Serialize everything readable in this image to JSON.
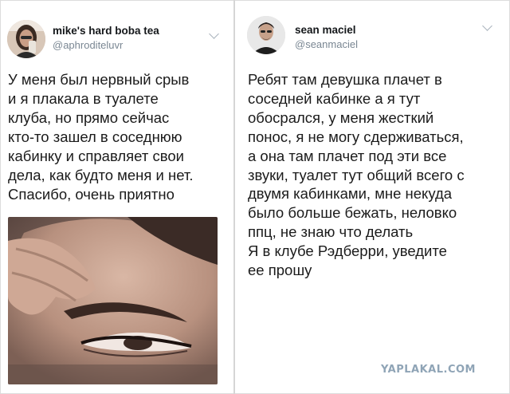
{
  "left_tweet": {
    "display_name": "mike's hard boba tea",
    "handle": "@aphroditeluvr",
    "text_lines": [
      "У меня был нервный срыв",
      "и я плакала в туалете",
      "клуба, но прямо сейчас",
      "кто-то зашел в соседнюю",
      "кабинку и справляет свои",
      "дела, как будто меня и нет.",
      "Спасибо, очень приятно"
    ],
    "avatar_icon": "selfie-avatar",
    "menu_icon": "chevron-down-icon"
  },
  "right_tweet": {
    "display_name": "sean maciel",
    "handle": "@seanmaciel",
    "text_lines": [
      "Ребят там девушка плачет в",
      "соседней кабинке а я тут",
      "обосрался, у меня жесткий",
      "понос, я не могу сдерживаться,",
      "а она там плачет под эти все",
      "звуки, туалет тут общий всего с",
      "двумя кабинками, мне некуда",
      "было больше бежать, неловко",
      "ппц, не знаю что делать",
      "Я в клубе Рэдберри, уведите",
      "ее прошу"
    ],
    "avatar_icon": "man-portrait-avatar",
    "menu_icon": "chevron-down-icon"
  },
  "watermark": "YAPLAKAL.COM",
  "colors": {
    "name": "#14171a",
    "handle": "#7a8793",
    "body_text": "#1b1b1b",
    "divider": "#d6d6d6",
    "watermark": "#8fa4b6"
  }
}
